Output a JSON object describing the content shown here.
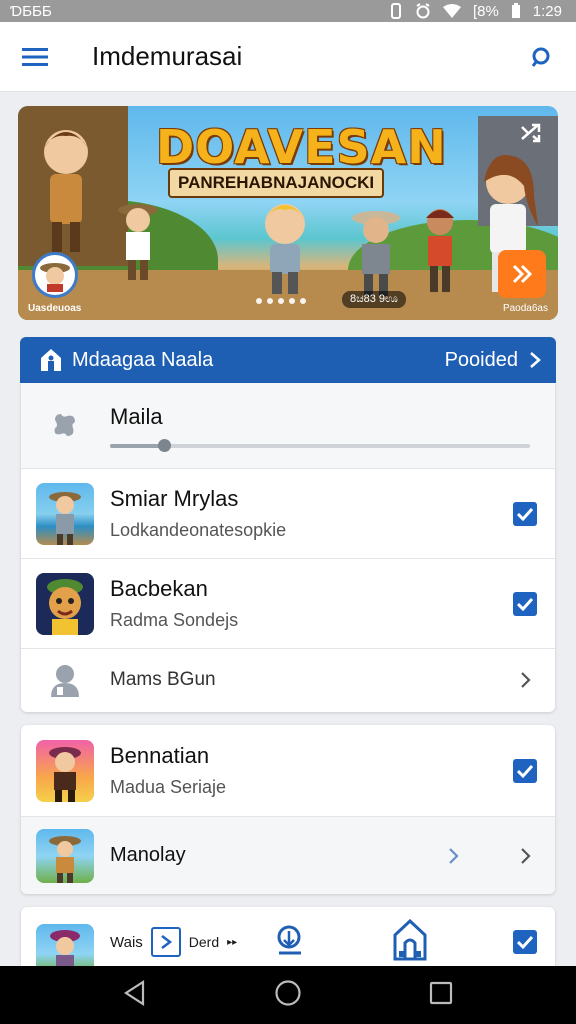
{
  "status_bar": {
    "time_left": "ƊƂƂƂ",
    "battery": "[8%",
    "clock": "1:29"
  },
  "app_bar": {
    "title": "Imdemurasai"
  },
  "banner": {
    "title": "DOAVESAN",
    "subtitle": "PANREHABNAJANOCKI",
    "avatar_label": "Uasdeuoas",
    "pill_text": "8ಚ83 9ಊ",
    "play_label": "Paoda6as"
  },
  "section": {
    "title": "Mdaagaa Naala",
    "action": "Pooided"
  },
  "rows": [
    {
      "title": "Maila",
      "subtitle": ""
    },
    {
      "title": "Smiar Mrylas",
      "subtitle": "Lodkandeonatesopkie"
    },
    {
      "title": "Bacbekan",
      "subtitle": "Radma Sondejs"
    },
    {
      "title": "Mams BGun"
    },
    {
      "title": "Bennatian",
      "subtitle": "Madua Seriaje"
    },
    {
      "title": "Manolay"
    },
    {
      "title": "Wais",
      "extra": "Derd"
    }
  ],
  "colors": {
    "accent": "#1e5fb4",
    "check": "#1e63c0",
    "banner_title": "#f6b21b",
    "play": "#ff7a1a"
  }
}
